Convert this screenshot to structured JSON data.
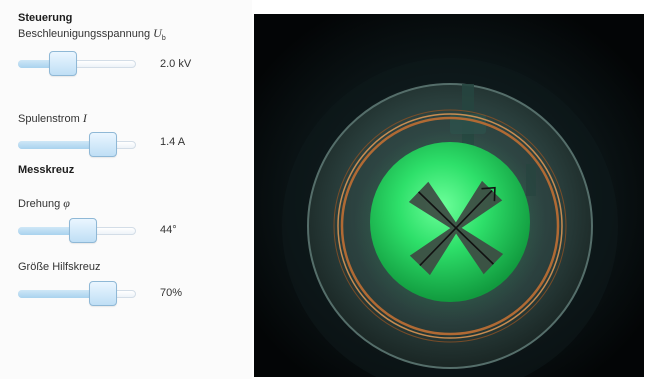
{
  "panel": {
    "steuerung_title": "Steuerung",
    "voltage": {
      "label": "Beschleunigungsspannung",
      "symbol": "U",
      "subscript": "b",
      "value_text": "2.0 kV",
      "level": 0.38
    },
    "current": {
      "label": "Spulenstrom",
      "symbol": "I",
      "value_text": "1.4 A",
      "level": 0.72
    },
    "messkreuz_title": "Messkreuz",
    "rotation": {
      "label": "Drehung",
      "symbol": "φ",
      "value_text": "44°",
      "level": 0.55
    },
    "size": {
      "label": "Größe Hilfskreuz",
      "value_text": "70%",
      "level": 0.72
    }
  },
  "scene": {
    "background_color": "#05080a",
    "glow_color": "#2ee06a",
    "ring_color": "#c87a3e",
    "arrow_angle_deg": 44
  }
}
